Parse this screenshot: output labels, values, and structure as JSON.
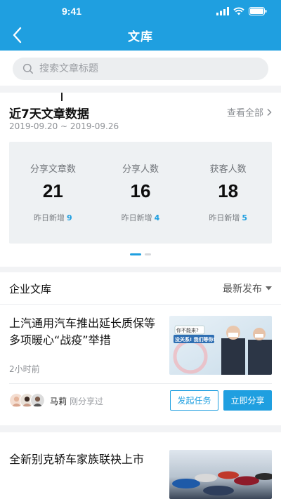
{
  "status": {
    "time": "9:41"
  },
  "nav": {
    "title": "文库"
  },
  "search": {
    "placeholder": "搜索文章标题"
  },
  "stats": {
    "title": "近7天文章数据",
    "range": "2019-09.20 ~ 2019-09.26",
    "view_all": "查看全部",
    "items": [
      {
        "label": "分享文章数",
        "value": "21",
        "inc_label": "昨日新增",
        "inc_value": "9"
      },
      {
        "label": "分享人数",
        "value": "16",
        "inc_label": "昨日新增",
        "inc_value": "4"
      },
      {
        "label": "获客人数",
        "value": "18",
        "inc_label": "昨日新增",
        "inc_value": "5"
      }
    ],
    "page_indicator": {
      "total": 2,
      "active": 1
    }
  },
  "library": {
    "title": "企业文库",
    "sort_label": "最新发布",
    "articles": [
      {
        "title": "上汽通用汽车推出延长质保等多项暖心“战疫”举措",
        "time": "2小时前",
        "thumb_text_1": "你不能来?",
        "thumb_text_2": "没关系! 我们等你!",
        "sharer_name": "马莉",
        "sharer_note": "刚分享过",
        "btn_task": "发起任务",
        "btn_share": "立即分享"
      },
      {
        "title": "全新别克轿车家族联袂上市"
      }
    ]
  },
  "colors": {
    "accent": "#1f9fe0",
    "background": "#f2f3f5"
  }
}
